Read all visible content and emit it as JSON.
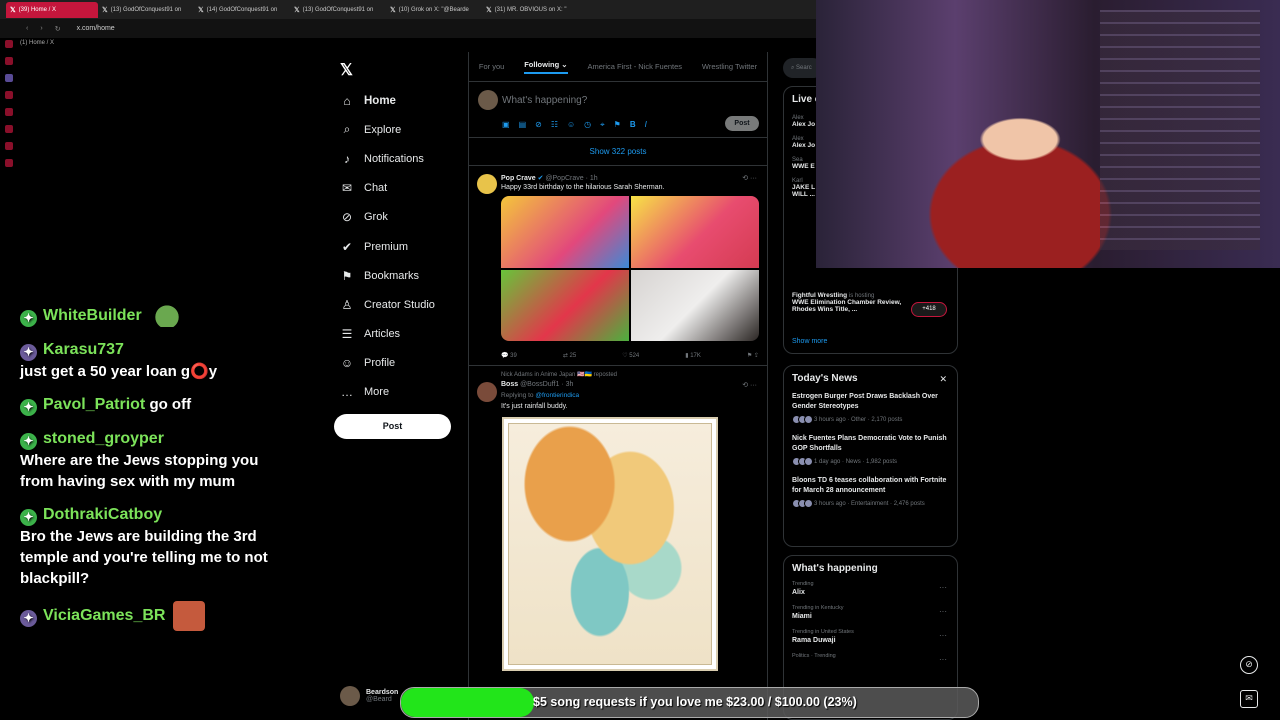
{
  "browser": {
    "tabs": [
      {
        "label": "(39) Home / X"
      },
      {
        "label": "(13) GodOfConquest91 on"
      },
      {
        "label": "(14) GodOfConquest91 on"
      },
      {
        "label": "(13) GodOfConquest91 on"
      },
      {
        "label": "(10) Grok on X: \"@Bearde"
      },
      {
        "label": "(31) MR. OBVIOUS on X: \""
      }
    ],
    "url": "x.com/home",
    "bookmark": "(1) Home / X"
  },
  "chat": [
    {
      "user": "WhiteBuilder",
      "text": "",
      "emote": "frog"
    },
    {
      "user": "Karasu737",
      "text": "just get a 50 year loan g⭕y",
      "emote": ""
    },
    {
      "user": "Pavol_Patriot",
      "text": "go off",
      "emote": ""
    },
    {
      "user": "stoned_groyper",
      "text": "Where are the Jews stopping you from having sex with my mum",
      "emote": ""
    },
    {
      "user": "DothrakiCatboy",
      "text": "Bro the Jews are building the 3rd temple and you're telling me to not blackpill?",
      "emote": ""
    },
    {
      "user": "ViciaGames_BR",
      "text": "",
      "emote": "face"
    }
  ],
  "nav": {
    "items": [
      {
        "label": "Home",
        "icon": "home-icon",
        "glyph": "⌂"
      },
      {
        "label": "Explore",
        "icon": "search-icon",
        "glyph": "⌕"
      },
      {
        "label": "Notifications",
        "icon": "bell-icon",
        "glyph": "♪"
      },
      {
        "label": "Chat",
        "icon": "chat-icon",
        "glyph": "✉"
      },
      {
        "label": "Grok",
        "icon": "grok-icon",
        "glyph": "⊘"
      },
      {
        "label": "Premium",
        "icon": "premium-icon",
        "glyph": "✔"
      },
      {
        "label": "Bookmarks",
        "icon": "bookmark-icon",
        "glyph": "⚑"
      },
      {
        "label": "Creator Studio",
        "icon": "creator-icon",
        "glyph": "♙"
      },
      {
        "label": "Articles",
        "icon": "articles-icon",
        "glyph": "☰"
      },
      {
        "label": "Profile",
        "icon": "profile-icon",
        "glyph": "☺"
      },
      {
        "label": "More",
        "icon": "more-icon",
        "glyph": "…"
      }
    ],
    "post_label": "Post",
    "profile_name": "Beardson",
    "profile_handle": "@Beard"
  },
  "timeline": {
    "tabs": [
      "For you",
      "Following ⌄",
      "America First - Nick Fuentes",
      "Wrestling Twitter"
    ],
    "composer_placeholder": "What's happening?",
    "composer_post": "Post",
    "show_posts": "Show 322 posts",
    "tweet1": {
      "name": "Pop Crave",
      "handle": "@PopCrave · 1h",
      "text": "Happy 33rd birthday to the hilarious Sarah Sherman.",
      "replies": "39",
      "reposts": "25",
      "likes": "524",
      "views": "17K"
    },
    "tweet2": {
      "repost": "Nick Adams in Anime Japan 🇺🇸🇺🇦 reposted",
      "name": "Boss",
      "handle": "@BossDuff1 · 3h",
      "reply_prefix": "Replying to",
      "reply_to": "@frontierindica",
      "text": "It's just rainfall buddy."
    }
  },
  "right": {
    "search": "Searc",
    "live_title": "Live o",
    "live_items": [
      {
        "name": "Alex",
        "text": "Alex Jo"
      },
      {
        "name": "Alex",
        "text": "Alex Jo"
      },
      {
        "name": "Sea",
        "text": "WWE E Review"
      },
      {
        "name": "Karl",
        "text": "JAKE L ISLAM RALLY. WHAT WILL ..."
      }
    ],
    "fightful": {
      "name": "Fightful Wrestling",
      "meta": "is hosting",
      "text": "WWE Elimination Chamber Review, Rhodes Wins Title, ...",
      "count": "+418"
    },
    "show_more": "Show more",
    "news_title": "Today's News",
    "news": [
      {
        "title": "Estrogen Burger Post Draws Backlash Over Gender Stereotypes",
        "meta": "3 hours ago · Other · 2,170 posts"
      },
      {
        "title": "Nick Fuentes Plans Democratic Vote to Punish GOP Shortfalls",
        "meta": "1 day ago · News · 1,982 posts"
      },
      {
        "title": "Bloons TD 6 teases collaboration with Fortnite for March 28 announcement",
        "meta": "3 hours ago · Entertainment · 2,476 posts"
      }
    ],
    "happening_title": "What's happening",
    "trends": [
      {
        "context": "Trending",
        "name": "Alix"
      },
      {
        "context": "Trending in Kentucky",
        "name": "Miami"
      },
      {
        "context": "Trending in United States",
        "name": "Rama Duwaji"
      },
      {
        "context": "Politics · Trending",
        "name": ""
      }
    ]
  },
  "donation": {
    "text": "$5 song requests if you love me $23.00 / $100.00 (23%)",
    "progress": 0.23,
    "color": "#22e51a"
  }
}
